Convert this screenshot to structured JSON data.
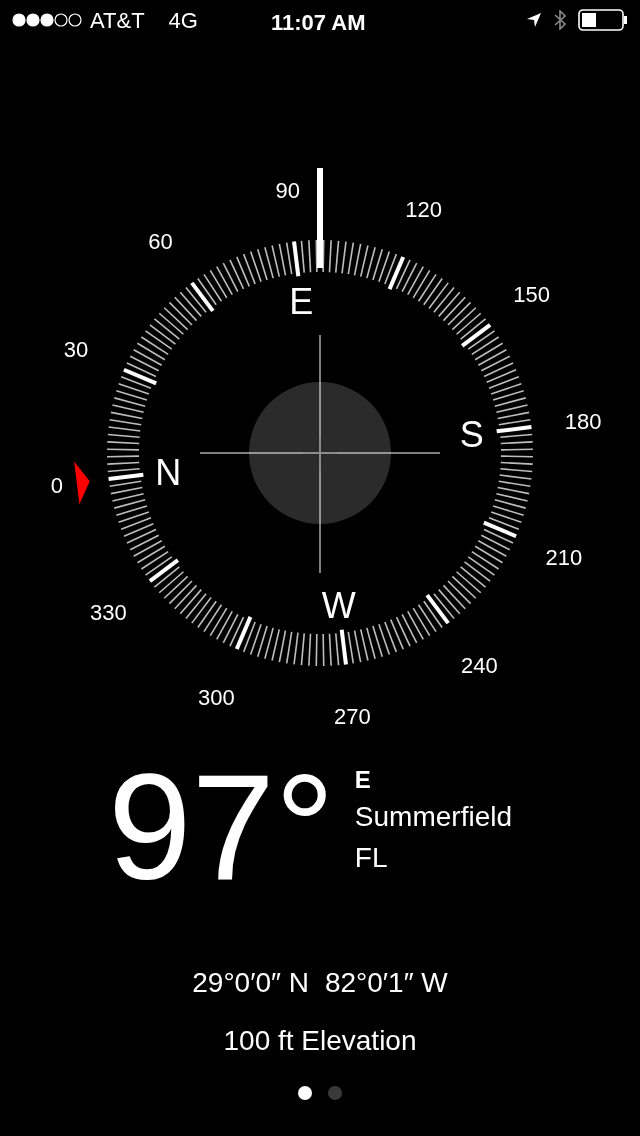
{
  "status_bar": {
    "carrier": "AT&T",
    "network": "4G",
    "time": "11:07 AM"
  },
  "compass": {
    "degree_labels": [
      "0",
      "30",
      "60",
      "90",
      "120",
      "150",
      "180",
      "210",
      "240",
      "270",
      "300",
      "330"
    ],
    "cardinals": [
      "N",
      "E",
      "S",
      "W"
    ]
  },
  "reading": {
    "heading": "97°",
    "direction": "E",
    "place": "Summerfield",
    "region": "FL"
  },
  "coordinates": [
    "29°0′0″ N",
    "82°0′1″ W"
  ],
  "elevation": "100 ft Elevation",
  "page_dots": [
    {
      "selected": true
    },
    {
      "selected": false
    }
  ]
}
